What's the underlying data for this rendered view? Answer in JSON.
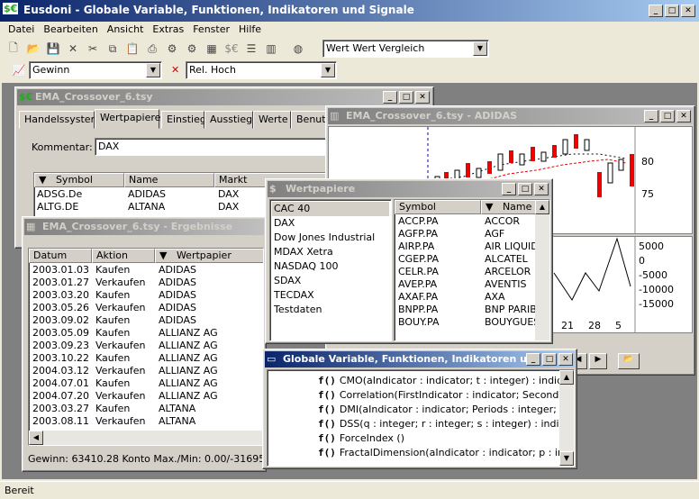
{
  "app": {
    "title": "Eusdoni - Globale Variable, Funktionen, Indikatoren und Signale",
    "logo": "$€"
  },
  "menu": [
    "Datei",
    "Bearbeiten",
    "Ansicht",
    "Extras",
    "Fenster",
    "Hilfe"
  ],
  "toolbar": {
    "compare_combo": "Wert Wert Vergleich",
    "gewinn_combo": "Gewinn",
    "relhoch_combo": "Rel. Hoch"
  },
  "ema_window": {
    "title": "EMA_Crossover_6.tsy",
    "tabs": [
      "Handelssystem",
      "Wertpapiere",
      "Einstieg",
      "Ausstieg",
      "Werte",
      "Benutz"
    ],
    "comment_label": "Kommentar:",
    "comment_value": "DAX",
    "columns": [
      "Symbol",
      "Name",
      "Markt"
    ],
    "rows": [
      [
        "ADSG.De",
        "ADIDAS",
        "DAX"
      ],
      [
        "ALTG.DE",
        "ALTANA",
        "DAX"
      ]
    ]
  },
  "chart_window": {
    "title": "EMA_Crossover_6.tsy - ADIDAS",
    "price_ticks": [
      "80",
      "75"
    ],
    "osc_ticks": [
      "5000",
      "0",
      "-5000",
      "-10000",
      "-15000"
    ],
    "date_ticks": [
      "21",
      "28",
      "5"
    ]
  },
  "results_window": {
    "title": "EMA_Crossover_6.tsy - Ergebnisse",
    "columns": [
      "Datum",
      "Aktion",
      "Wertpapier"
    ],
    "rows": [
      [
        "2003.01.03",
        "Kaufen",
        "ADIDAS"
      ],
      [
        "2003.01.27",
        "Verkaufen",
        "ADIDAS"
      ],
      [
        "2003.03.20",
        "Kaufen",
        "ADIDAS"
      ],
      [
        "2003.05.26",
        "Verkaufen",
        "ADIDAS"
      ],
      [
        "2003.09.02",
        "Kaufen",
        "ADIDAS"
      ],
      [
        "2003.05.09",
        "Kaufen",
        "ALLIANZ AG"
      ],
      [
        "2003.09.23",
        "Verkaufen",
        "ALLIANZ AG"
      ],
      [
        "2003.10.22",
        "Kaufen",
        "ALLIANZ AG"
      ],
      [
        "2004.03.12",
        "Verkaufen",
        "ALLIANZ AG"
      ],
      [
        "2004.07.01",
        "Kaufen",
        "ALLIANZ AG"
      ],
      [
        "2004.07.20",
        "Verkaufen",
        "ALLIANZ AG"
      ],
      [
        "2003.03.27",
        "Kaufen",
        "ALTANA"
      ],
      [
        "2003.08.11",
        "Verkaufen",
        "ALTANA"
      ]
    ],
    "footer": "Gewinn: 63410.28 Konto Max./Min: 0.00/-316957.04 ("
  },
  "wertpapiere_window": {
    "title": "Wertpapiere",
    "indices": [
      "CAC 40",
      "DAX",
      "Dow Jones Industrial",
      "MDAX Xetra",
      "NASDAQ 100",
      "SDAX",
      "TECDAX",
      "Testdaten"
    ],
    "columns": [
      "Symbol",
      "Name"
    ],
    "rows": [
      [
        "ACCP.PA",
        "ACCOR"
      ],
      [
        "AGFP.PA",
        "AGF"
      ],
      [
        "AIRP.PA",
        "AIR LIQUID"
      ],
      [
        "CGEP.PA",
        "ALCATEL"
      ],
      [
        "CELR.PA",
        "ARCELOR"
      ],
      [
        "AVEP.PA",
        "AVENTIS"
      ],
      [
        "AXAF.PA",
        "AXA"
      ],
      [
        "BNPP.PA",
        "BNP PARIB"
      ],
      [
        "BOUY.PA",
        "BOUYGUES"
      ]
    ]
  },
  "globale_window": {
    "title": "Globale Variable, Funktionen, Indikatoren und ...",
    "items": [
      "CMO(aIndicator : indicator; t : integer) : indicator",
      "Correlation(FirstIndicator : indicator; SecondIndicat",
      "DMI(aIndicator : indicator; Periods : integer; StDevP",
      "DSS(q : integer; r : integer; s : integer) : indicator",
      "ForceIndex ()",
      "FractalDimension(aIndicator : indicator; p : integer)"
    ]
  },
  "status": "Bereit",
  "colors": {
    "title_active": "#0a246a",
    "title_inactive": "#808080",
    "candle_up": "#ffffff",
    "candle_down": "#e00000"
  }
}
